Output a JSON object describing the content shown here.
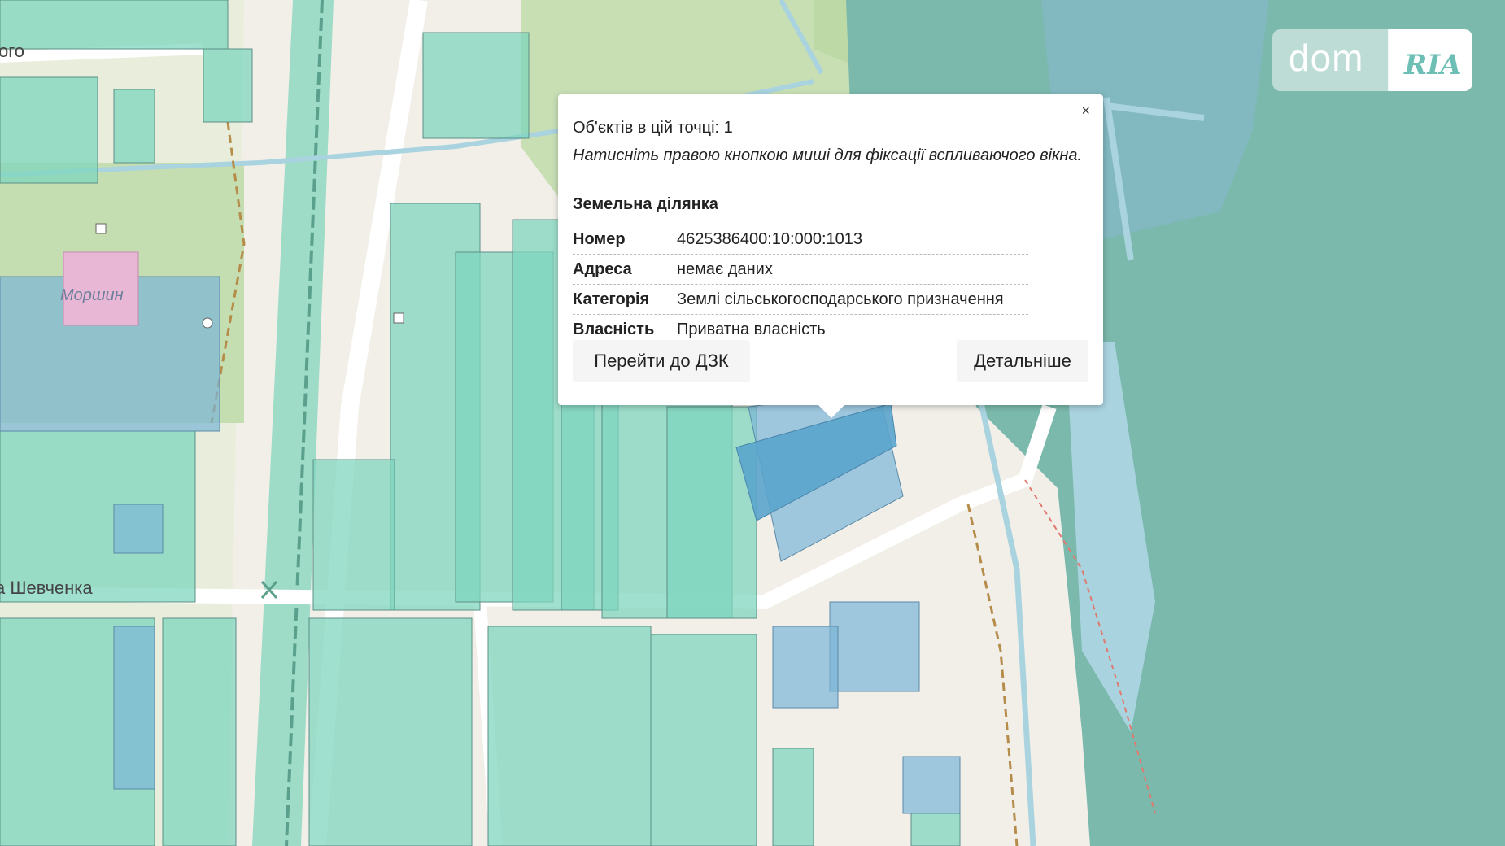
{
  "map": {
    "street_label_1": "а Шевченка",
    "street_label_2": "ого",
    "town_label": "Моршин"
  },
  "popup": {
    "close_label": "×",
    "count_text": "Об'єктів в цій точці: 1",
    "hint_text": "Натисніть правою кнопкою миші для фіксації вспливаючого вікна.",
    "section_title": "Земельна ділянка",
    "properties": [
      {
        "key": "Номер",
        "value": "4625386400:10:000:1013"
      },
      {
        "key": "Адреса",
        "value": "немає даних"
      },
      {
        "key": "Категорія",
        "value": "Землі сільськогосподарського призначення"
      },
      {
        "key": "Власність",
        "value": "Приватна власність"
      }
    ],
    "btn_dzk": "Перейти до ДЗК",
    "btn_more": "Детальніше"
  },
  "logo": {
    "dom": "dom",
    "ria": "RIA"
  },
  "colors": {
    "parcel_green": "#7fd6bd",
    "parcel_blue": "#7ab5d6",
    "selected_parcel": "#5aa4cc",
    "forest": "#7ab9ac",
    "water": "#a9d3df"
  }
}
